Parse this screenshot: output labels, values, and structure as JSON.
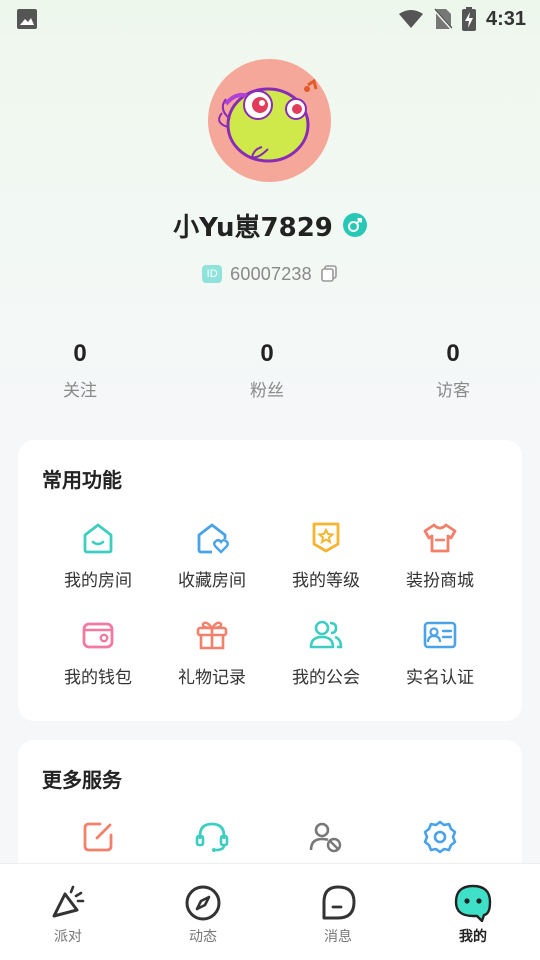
{
  "status_bar": {
    "time": "4:31",
    "icons": [
      "image-notification-icon",
      "wifi-icon",
      "no-sim-icon",
      "battery-charging-icon"
    ]
  },
  "profile": {
    "username": "小Yu崽7829",
    "gender": "male",
    "id_badge": "ID",
    "id_value": "60007238"
  },
  "stats": [
    {
      "value": "0",
      "label": "关注"
    },
    {
      "value": "0",
      "label": "粉丝"
    },
    {
      "value": "0",
      "label": "访客"
    }
  ],
  "common_functions": {
    "title": "常用功能",
    "items": [
      {
        "label": "我的房间",
        "icon": "home-icon",
        "color": "#3ccfc1"
      },
      {
        "label": "收藏房间",
        "icon": "home-heart-icon",
        "color": "#4aa3e8"
      },
      {
        "label": "我的等级",
        "icon": "level-badge-icon",
        "color": "#f5b530"
      },
      {
        "label": "装扮商城",
        "icon": "tshirt-icon",
        "color": "#f2806a"
      },
      {
        "label": "我的钱包",
        "icon": "wallet-icon",
        "color": "#f27aa0"
      },
      {
        "label": "礼物记录",
        "icon": "gift-icon",
        "color": "#f2806a"
      },
      {
        "label": "我的公会",
        "icon": "group-icon",
        "color": "#3ccfc1"
      },
      {
        "label": "实名认证",
        "icon": "id-card-icon",
        "color": "#4aa3e8"
      }
    ]
  },
  "more_services": {
    "title": "更多服务",
    "items": [
      {
        "icon": "edit-icon",
        "color": "#f2806a"
      },
      {
        "icon": "headset-icon",
        "color": "#3ccfc1"
      },
      {
        "icon": "user-block-icon",
        "color": "#777777"
      },
      {
        "icon": "settings-icon",
        "color": "#4aa3e8"
      }
    ]
  },
  "tabbar": {
    "items": [
      {
        "label": "派对",
        "icon": "party-icon",
        "active": false
      },
      {
        "label": "动态",
        "icon": "compass-icon",
        "active": false
      },
      {
        "label": "消息",
        "icon": "message-icon",
        "active": false
      },
      {
        "label": "我的",
        "icon": "mine-icon",
        "active": true
      }
    ]
  }
}
